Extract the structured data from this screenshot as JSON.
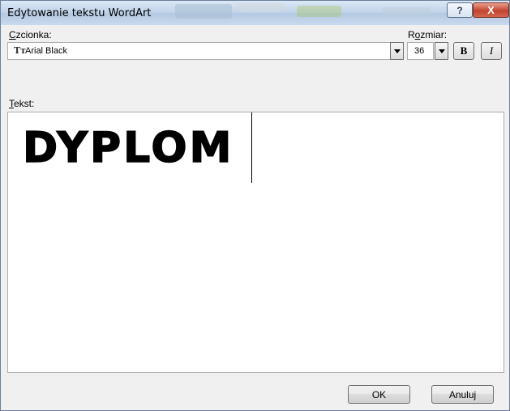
{
  "window": {
    "title": "Edytowanie tekstu WordArt",
    "help_label": "?",
    "close_label": "X"
  },
  "font": {
    "label_accel": "C",
    "label_rest": "zcionka:",
    "icon_glyph": "Tт",
    "value": "Arial Black"
  },
  "size": {
    "label_pre": "R",
    "label_accel": "o",
    "label_rest": "zmiar:",
    "value": "36"
  },
  "format": {
    "bold_label": "B",
    "italic_label": "I"
  },
  "text": {
    "label_accel": "T",
    "label_rest": "ekst:",
    "value": "DYPLOM"
  },
  "buttons": {
    "ok": "OK",
    "cancel": "Anuluj"
  }
}
